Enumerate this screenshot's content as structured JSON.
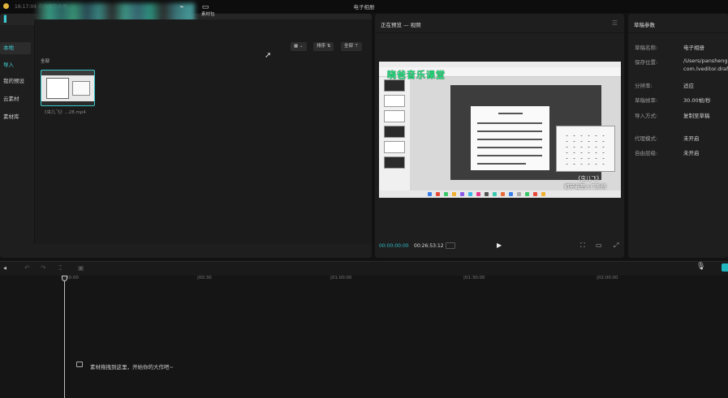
{
  "titlebar": {
    "status": "16:17:04 自动保存本地",
    "title": "电子相册"
  },
  "media_toolbar": {
    "export_label": "素材包"
  },
  "media_nav": {
    "items": [
      {
        "label": "本地",
        "active": true
      },
      {
        "label": "导入"
      },
      {
        "label": "我的预设"
      },
      {
        "label": "云素材"
      },
      {
        "label": "素材库"
      }
    ]
  },
  "media_content": {
    "sort_label": "排序",
    "filter_label": "全部",
    "section_label": "全部",
    "clip": {
      "name": "《虫儿飞》...28.mp4"
    }
  },
  "player": {
    "title": "正在预览 — 视频",
    "video": {
      "overlay_title": "晓爸音乐课堂",
      "caption_line1": "《虫儿飞》",
      "caption_line2": "初学者至入门系统"
    },
    "timecode_current": "00:00:00:00",
    "timecode_total": "00:26:53:12"
  },
  "properties": {
    "title": "草稿参数",
    "rows": [
      {
        "key": "草稿名称:",
        "value": "电子相册"
      },
      {
        "key": "保存位置:",
        "value": "/Users/pansheng",
        "value2": "com.lveditor.draft"
      },
      {
        "key": "分辨率:",
        "value": "适应"
      },
      {
        "key": "草稿帧率:",
        "value": "30.00帧/秒"
      },
      {
        "key": "导入方式:",
        "value": "复制至草稿"
      },
      {
        "key": "代理模式:",
        "value": "未开启"
      },
      {
        "key": "自由层级:",
        "value": "未开启"
      }
    ]
  },
  "timeline": {
    "ruler": [
      "00:00",
      "|00:30",
      "|01:00:00",
      "|01:30:00",
      "|02:00:00"
    ],
    "empty_hint": "素材拖拽到这里，开始你的大作吧~"
  }
}
